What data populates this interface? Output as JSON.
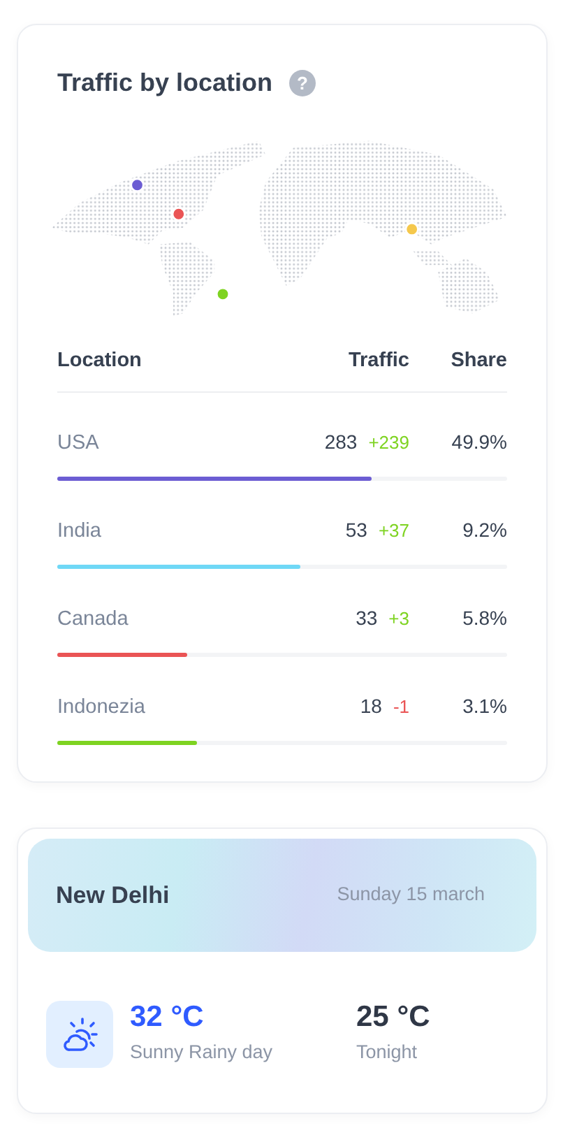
{
  "traffic": {
    "title": "Traffic by location",
    "help": "?",
    "map_pins": [
      {
        "color": "#6c5dd3"
      },
      {
        "color": "#ea5455"
      },
      {
        "color": "#f5c84c"
      },
      {
        "color": "#7ed321"
      }
    ],
    "columns": [
      "Location",
      "Traffic",
      "Share"
    ],
    "rows": [
      {
        "location": "USA",
        "traffic": "283",
        "change": "+239",
        "decrease": false,
        "share": "49.9%",
        "level": 0.7,
        "color": "#6c5dd3"
      },
      {
        "location": "India",
        "traffic": "53",
        "change": "+37",
        "decrease": false,
        "share": "9.2%",
        "level": 0.54,
        "color": "#6fd8f6"
      },
      {
        "location": "Canada",
        "traffic": "33",
        "change": "+3",
        "decrease": false,
        "share": "5.8%",
        "level": 0.29,
        "color": "#ea5455"
      },
      {
        "location": "Indonezia",
        "traffic": "18",
        "change": "-1",
        "decrease": true,
        "share": "3.1%",
        "level": 0.31,
        "color": "#7ed321"
      }
    ]
  },
  "weather": {
    "city": "New Delhi",
    "date": "Sunday 15 march",
    "temp": "32 °C",
    "condition": "Sunny Rainy day",
    "night_temp": "25 °C",
    "night_label": "Tonight"
  }
}
